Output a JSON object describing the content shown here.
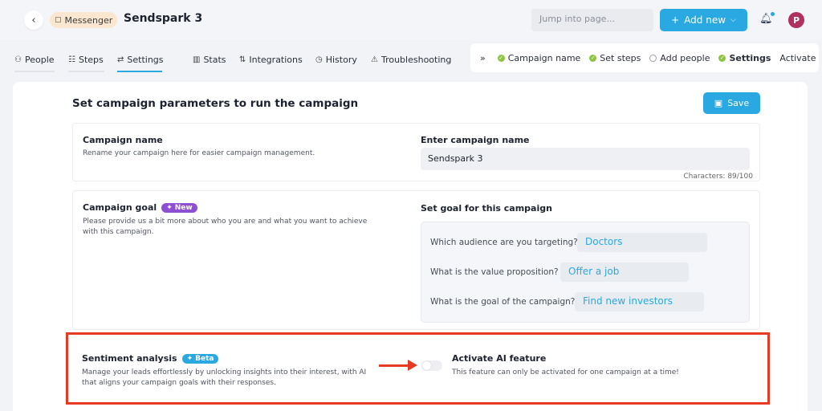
{
  "header": {
    "back_icon": "chevron-left-icon",
    "type_badge": "Messenger",
    "title": "Sendspark 3",
    "jump_placeholder": "Jump into page...",
    "add_new_label": "Add new",
    "avatar_initial": "P"
  },
  "tabs": [
    {
      "label": "People",
      "icon": "people-icon"
    },
    {
      "label": "Steps",
      "icon": "steps-icon"
    },
    {
      "label": "Settings",
      "icon": "settings-icon",
      "active": true
    },
    {
      "label": "Stats",
      "icon": "stats-icon"
    },
    {
      "label": "Integrations",
      "icon": "integrations-icon"
    },
    {
      "label": "History",
      "icon": "history-icon"
    },
    {
      "label": "Troubleshooting",
      "icon": "warning-icon"
    }
  ],
  "stepper": {
    "steps": [
      {
        "label": "Campaign name",
        "done": true
      },
      {
        "label": "Set steps",
        "done": true
      },
      {
        "label": "Add people",
        "done": false
      },
      {
        "label": "Settings",
        "done": true,
        "active": true
      },
      {
        "label": "Activate",
        "done": false
      }
    ]
  },
  "main": {
    "title": "Set campaign parameters to run the campaign",
    "save_label": "Save",
    "campaign_name": {
      "label": "Campaign name",
      "description": "Rename your campaign here for easier campaign management.",
      "input_label": "Enter campaign name",
      "value": "Sendspark 3",
      "chars": "Characters: 89/100"
    },
    "campaign_goal": {
      "label": "Campaign goal",
      "badge": "New",
      "description_line1": "Please provide us a bit more about who you are and what you want to achieve",
      "description_line2": "with this campaign.",
      "right_label": "Set goal for this campaign",
      "questions": [
        {
          "q": "Which audience are you targeting?",
          "a": "Doctors"
        },
        {
          "q": "What is the value proposition?",
          "a": "Offer a job"
        },
        {
          "q": "What is the goal of the campaign?",
          "a": "Find new investors"
        }
      ]
    },
    "sentiment": {
      "label": "Sentiment analysis",
      "badge": "Beta",
      "description_line1": "Manage your leads effortlessly by unlocking insights into their interest, with AI",
      "description_line2": "that aligns your campaign goals with their responses.",
      "toggle_on": false,
      "right_label": "Activate AI feature",
      "right_description": "This feature can only be activated for one campaign at a time!"
    }
  },
  "colors": {
    "accent": "#29a8e1",
    "highlight": "#e63b22",
    "new_badge": "#8f4fd3",
    "done_step": "#8bc53f"
  }
}
